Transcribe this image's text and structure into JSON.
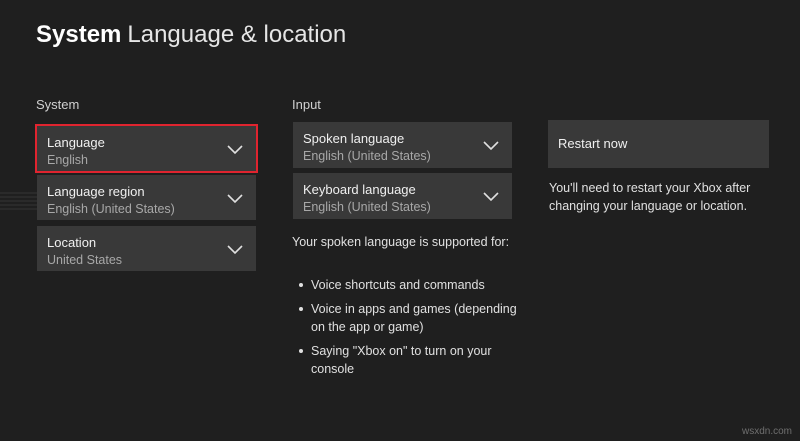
{
  "header": {
    "title_bold": "System",
    "title_light": "Language & location"
  },
  "system": {
    "section_label": "System",
    "language": {
      "label": "Language",
      "value": "English"
    },
    "region": {
      "label": "Language region",
      "value": "English (United States)"
    },
    "location": {
      "label": "Location",
      "value": "United States"
    }
  },
  "input": {
    "section_label": "Input",
    "spoken": {
      "label": "Spoken language",
      "value": "English (United States)"
    },
    "keyboard": {
      "label": "Keyboard language",
      "value": "English (United States)"
    },
    "support_text": "Your spoken language is supported for:",
    "bullets": [
      "Voice shortcuts and commands",
      "Voice in apps and games (depending on the app or game)",
      "Saying \"Xbox on\" to turn on your console"
    ]
  },
  "restart": {
    "button_label": "Restart now",
    "note": "You'll need to restart your Xbox after changing your language or location."
  },
  "watermark": "wsxdn.com",
  "icons": {
    "chevron": "chevron-down-icon"
  },
  "colors": {
    "background": "#1f1f1f",
    "tile": "#393939",
    "focus": "#e0242f"
  }
}
